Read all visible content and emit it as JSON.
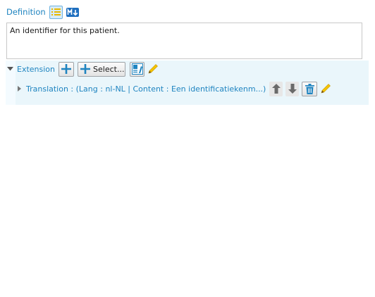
{
  "definition": {
    "label": "Definition",
    "text": "An identifier for this patient."
  },
  "extension": {
    "label": "Extension",
    "select_label": "Select..."
  },
  "translation": {
    "label": "Translation : (Lang : nl-NL | Content : Een identificatiekenm...)"
  },
  "icons": [
    "list-icon",
    "markdown-icon",
    "collapse-arrow-icon",
    "add-icon",
    "edit-metadata-icon",
    "pencil-icon",
    "expand-arrow-icon",
    "arrow-up-icon",
    "arrow-down-icon",
    "trash-icon"
  ],
  "colors": {
    "accent": "#1f84c0",
    "panel_bg": "#eaf6fb",
    "pencil": "#f5c400"
  }
}
